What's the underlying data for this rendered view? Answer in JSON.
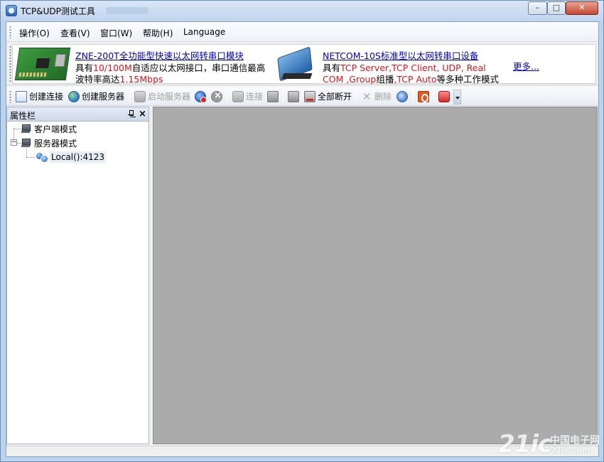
{
  "window": {
    "title": "TCP&UDP测试工具",
    "controls": {
      "minimize": "–",
      "maximize": "□",
      "close": "✕"
    }
  },
  "menu": {
    "items": [
      {
        "label": "操作(O)"
      },
      {
        "label": "查看(V)"
      },
      {
        "label": "窗口(W)"
      },
      {
        "label": "帮助(H)"
      },
      {
        "label": "Language"
      }
    ]
  },
  "ads": {
    "left": {
      "link": "ZNE-200T全功能型快速以太网转串口模块",
      "line1_pre": "具有",
      "line1_red": "10/100M",
      "line1_post": "自适应以太网接口，串口通信最高",
      "line2_pre": "波特率高达",
      "line2_red": "1.15Mbps"
    },
    "right": {
      "link": "NETCOM-10S标准型以太网转串口设备",
      "line1_pre": "具有",
      "line1_red": "TCP Server,TCP Client, UDP, Real",
      "line2_red1": "COM ,Group",
      "line2_mid": "组播",
      "line2_red2": ",TCP Auto",
      "line2_post": "等多种工作模式"
    },
    "more": "更多..."
  },
  "toolbar": {
    "create_connection": "创建连接",
    "create_server": "创建服务器",
    "start_server": "启动服务器",
    "connect": "连接",
    "disconnect_all": "全部断开",
    "delete": "删除"
  },
  "panel": {
    "title": "属性栏",
    "pin": "pin-icon",
    "close": "×",
    "tree": {
      "client_mode": "客户端模式",
      "server_mode": "服务器模式",
      "server_child": "Local():4123",
      "expander": "−"
    }
  },
  "watermark": {
    "big": "21ic",
    "small": "中国电子网",
    "url": "21ic.com"
  },
  "colors": {
    "accent_red": "#e8101a",
    "link_blue": "#0000cc",
    "mdi_background": "#ababab"
  }
}
